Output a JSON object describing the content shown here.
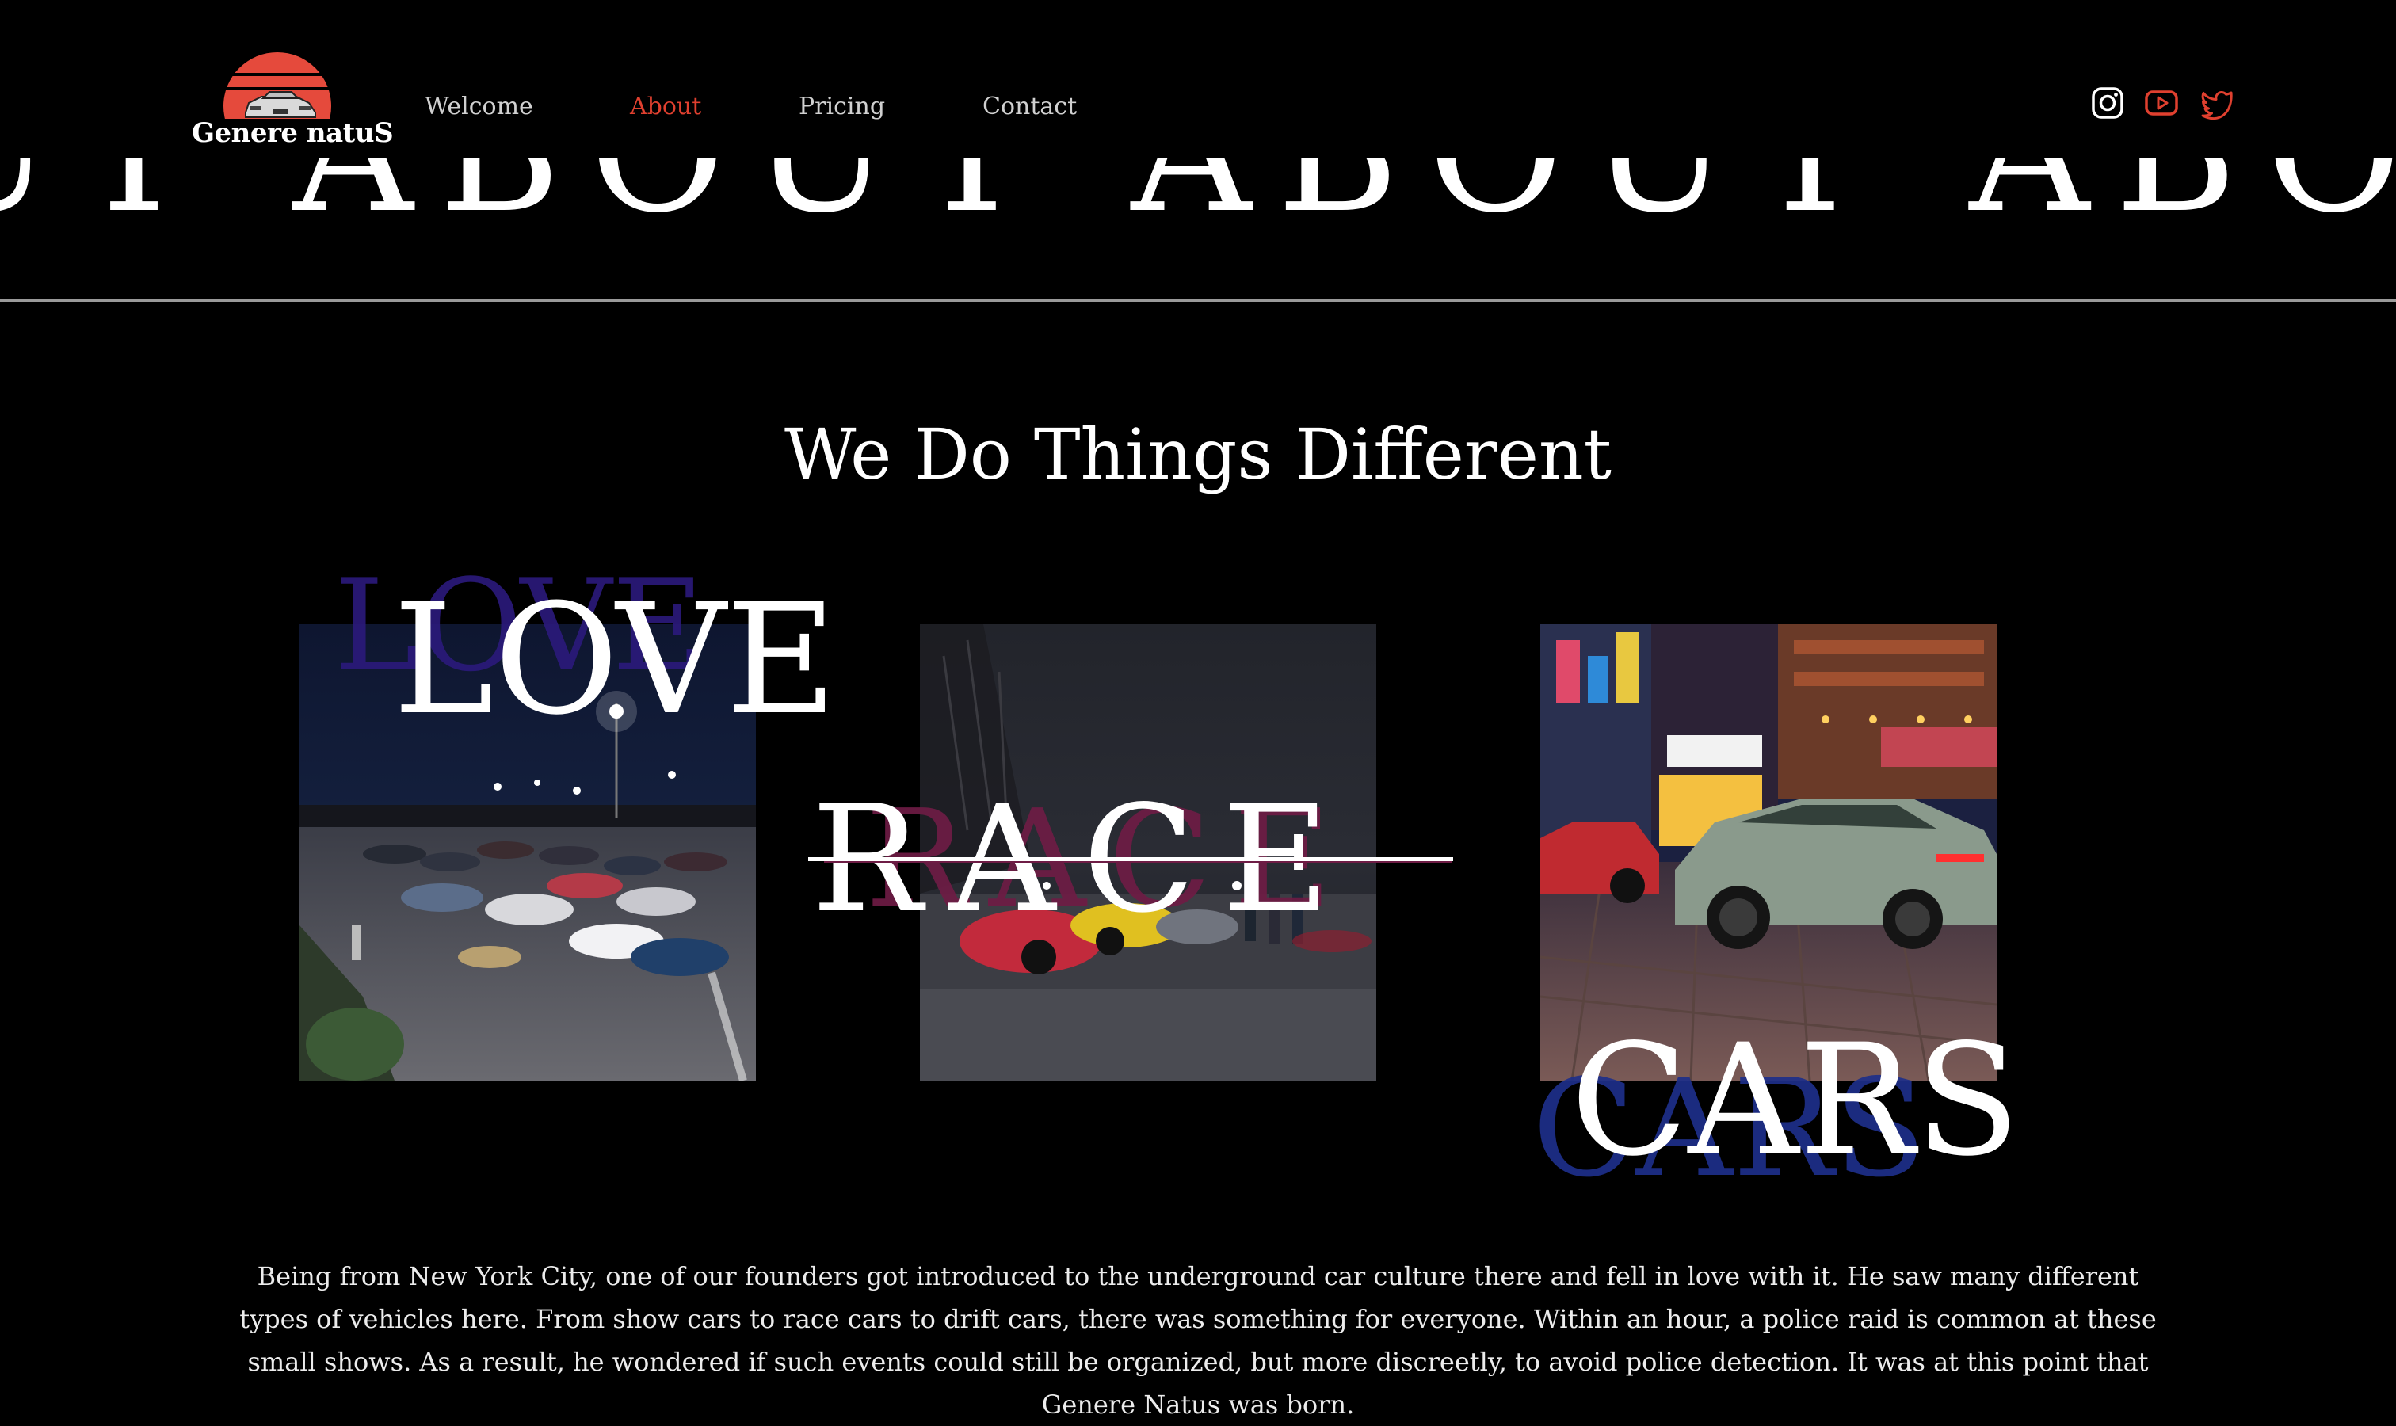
{
  "brand": {
    "name": "Genere natuS",
    "logo_color": "#e54a3c"
  },
  "nav": {
    "items": [
      {
        "label": "Welcome",
        "active": false
      },
      {
        "label": "About",
        "active": true
      },
      {
        "label": "Pricing",
        "active": false
      },
      {
        "label": "Contact",
        "active": false
      }
    ],
    "active_color": "#e0402f"
  },
  "social": {
    "icons": [
      "instagram-icon",
      "youtube-icon",
      "twitter-icon"
    ],
    "color": "#e0402f"
  },
  "marquee": {
    "text": "UT ABOUT ABOUT ABOUT ABOUT ABOUT AB"
  },
  "heading": {
    "title": "We Do Things Different"
  },
  "cards": [
    {
      "word": "LOVE",
      "ghost_color": "#2b1a7a"
    },
    {
      "word": "RACE",
      "ghost_color": "#6e1c45"
    },
    {
      "word": "CARS",
      "ghost_color": "#1e2f8a"
    }
  ],
  "about": {
    "paragraph": "Being from New York City, one of our founders got introduced to the underground car culture there and fell in love with it. He saw many different types of vehicles here. From show cars to race cars to drift cars, there was something for everyone. Within an hour, a police raid is common at these small shows. As a result, he wondered if such events could still be organized, but more discreetly, to avoid police detection. It was at this point that Genere Natus was born."
  }
}
